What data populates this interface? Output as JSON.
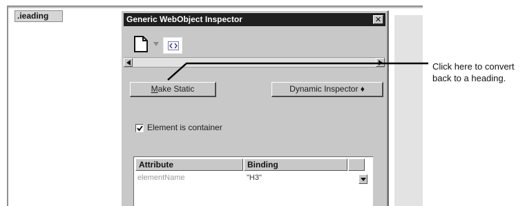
{
  "editor": {
    "heading_label": ".ieading"
  },
  "inspector": {
    "title": "Generic WebObject Inspector",
    "make_static_prefix": "M",
    "make_static_rest": "ake Static",
    "dynamic_inspector": "Dynamic Inspector ♦",
    "checkbox_label": "Element is container",
    "checkbox_checked": true,
    "table": {
      "headers": [
        "Attribute",
        "Binding",
        ""
      ],
      "rows": [
        {
          "attribute": "elementName",
          "binding": "\"H3\""
        }
      ]
    }
  },
  "callout": {
    "line1": "Click here to convert",
    "line2": "back to a heading."
  }
}
